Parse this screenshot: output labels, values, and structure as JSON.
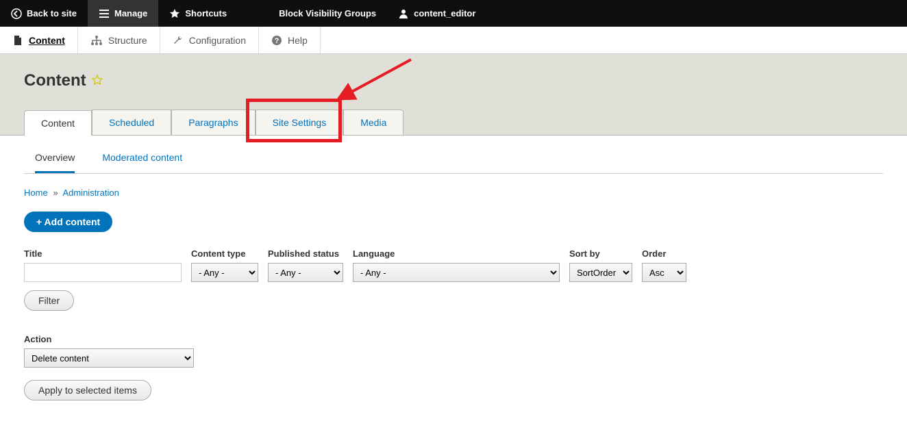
{
  "toolbar": {
    "back_to_site": "Back to site",
    "manage": "Manage",
    "shortcuts": "Shortcuts",
    "site_name": "Block Visibility Groups",
    "user": "content_editor"
  },
  "admin_menu": {
    "content": "Content",
    "structure": "Structure",
    "configuration": "Configuration",
    "help": "Help"
  },
  "page": {
    "title": "Content"
  },
  "primary_tabs": [
    {
      "label": "Content",
      "active": true
    },
    {
      "label": "Scheduled",
      "active": false
    },
    {
      "label": "Paragraphs",
      "active": false
    },
    {
      "label": "Site Settings",
      "active": false
    },
    {
      "label": "Media",
      "active": false
    }
  ],
  "secondary_tabs": [
    {
      "label": "Overview",
      "active": true
    },
    {
      "label": "Moderated content",
      "active": false
    }
  ],
  "breadcrumb": {
    "home": "Home",
    "sep": "»",
    "admin": "Administration"
  },
  "buttons": {
    "add_content": "+ Add content",
    "filter": "Filter",
    "apply": "Apply to selected items"
  },
  "filters": {
    "title_label": "Title",
    "content_type_label": "Content type",
    "content_type_value": "- Any -",
    "published_status_label": "Published status",
    "published_status_value": "- Any -",
    "language_label": "Language",
    "language_value": "- Any -",
    "sort_by_label": "Sort by",
    "sort_by_value": "SortOrder",
    "order_label": "Order",
    "order_value": "Asc"
  },
  "action": {
    "label": "Action",
    "value": "Delete content"
  },
  "callout": {
    "highlighted_tab": "Site Settings",
    "color": "#e51c23"
  }
}
